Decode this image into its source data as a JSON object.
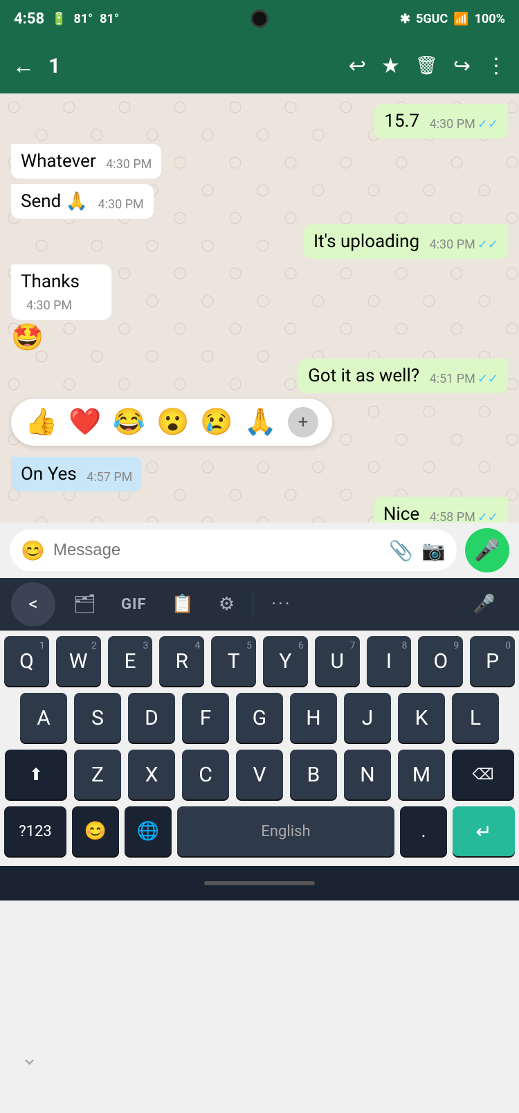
{
  "statusBar": {
    "time": "4:58",
    "battery_icon": "🔋",
    "battery_pct": "100%",
    "network": "5GUC",
    "signal": "📶",
    "bluetooth": "✱",
    "temp1": "81°",
    "temp2": "81°"
  },
  "header": {
    "back_label": "←",
    "count_label": "1",
    "reply_icon": "↩",
    "star_icon": "★",
    "trash_icon": "🗑",
    "forward_icon": "↪",
    "more_icon": "⋮"
  },
  "messages": [
    {
      "id": 1,
      "type": "sent",
      "text": "15.7",
      "time": "4:30 PM",
      "ticks": true
    },
    {
      "id": 2,
      "type": "received",
      "text": "Whatever",
      "time": "4:30 PM"
    },
    {
      "id": 3,
      "type": "received",
      "text": "Send 🙏",
      "time": "4:30 PM"
    },
    {
      "id": 4,
      "type": "sent",
      "text": "It's uploading",
      "time": "4:30 PM",
      "ticks": true
    },
    {
      "id": 5,
      "type": "received",
      "text": "Thanks",
      "time": "4:30 PM",
      "emoji_below": "🤩"
    },
    {
      "id": 6,
      "type": "sent",
      "text": "Got it as well?",
      "time": "4:51 PM",
      "ticks": true
    },
    {
      "id": 7,
      "type": "received",
      "text": "On Yes",
      "time": "4:57 PM",
      "highlighted": true,
      "has_reactions": true
    },
    {
      "id": 8,
      "type": "sent",
      "text": "Nice",
      "time": "4:58 PM",
      "ticks": true
    }
  ],
  "reactions": [
    "👍",
    "❤️",
    "😂",
    "😮",
    "😢",
    "🙏"
  ],
  "inputBar": {
    "placeholder": "Message",
    "emoji_icon": "😊",
    "attach_icon": "📎",
    "camera_icon": "📷",
    "mic_icon": "🎤"
  },
  "keyboard": {
    "toolbar": {
      "back": "<",
      "sticker": "🗂",
      "gif": "GIF",
      "clipboard": "📋",
      "settings": "⚙",
      "dots": "...",
      "mic": "🎤"
    },
    "rows": [
      [
        "Q",
        "W",
        "E",
        "R",
        "T",
        "Y",
        "U",
        "I",
        "O",
        "P"
      ],
      [
        "A",
        "S",
        "D",
        "F",
        "G",
        "H",
        "J",
        "K",
        "L"
      ],
      [
        "↑",
        "Z",
        "X",
        "C",
        "V",
        "B",
        "N",
        "M",
        "⌫"
      ],
      [
        "?123",
        "😊",
        "🌐",
        "English",
        ".",
        "↵"
      ]
    ],
    "numbers": [
      "1",
      "2",
      "3",
      "4",
      "5",
      "6",
      "7",
      "8",
      "9",
      "0"
    ]
  }
}
